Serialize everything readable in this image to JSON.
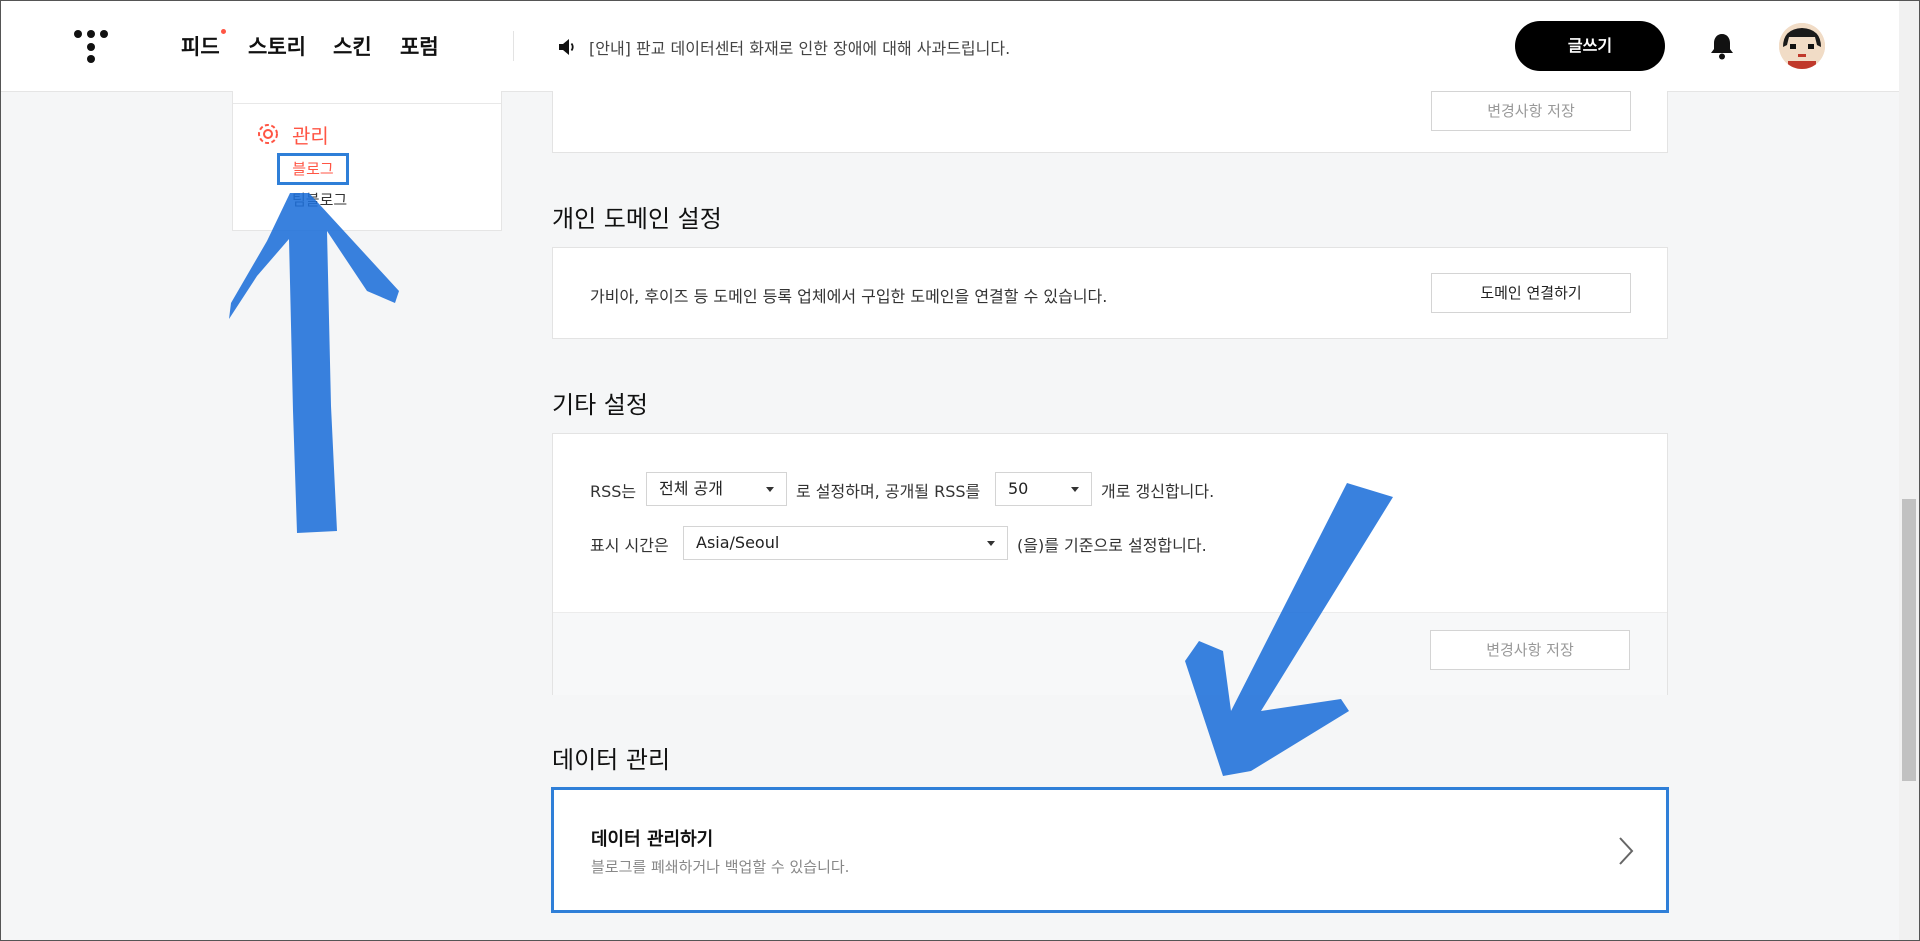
{
  "header": {
    "nav": [
      "피드",
      "스토리",
      "스킨",
      "포럼"
    ],
    "notice": "[안내] 판교 데이터센터 화재로 인한 장애에 대해 사과드립니다.",
    "write_label": "글쓰기"
  },
  "sidebar": {
    "manage_label": "관리",
    "sub_items": [
      "블로그",
      "팀블로그"
    ]
  },
  "sections": {
    "prev_save_label": "변경사항 저장",
    "domain": {
      "title": "개인 도메인 설정",
      "desc": "가비아, 후이즈 등 도메인 등록 업체에서 구입한 도메인을 연결할 수 있습니다.",
      "button": "도메인 연결하기"
    },
    "etc": {
      "title": "기타 설정",
      "rss_prefix": "RSS는",
      "rss_visibility": "전체 공개",
      "rss_mid": "로 설정하며, 공개될 RSS를",
      "rss_count": "50",
      "rss_suffix": "개로 갱신합니다.",
      "tz_prefix": "표시 시간은",
      "tz_value": "Asia/Seoul",
      "tz_suffix": "(을)를 기준으로 설정합니다.",
      "save_label": "변경사항 저장"
    },
    "data": {
      "title": "데이터 관리",
      "card_title": "데이터 관리하기",
      "card_desc": "블로그를 폐쇄하거나 백업할 수 있습니다."
    }
  },
  "colors": {
    "accent": "#ff5544",
    "annotation": "#2f7fd8",
    "annotation_arrow": "#1e6fd9"
  }
}
